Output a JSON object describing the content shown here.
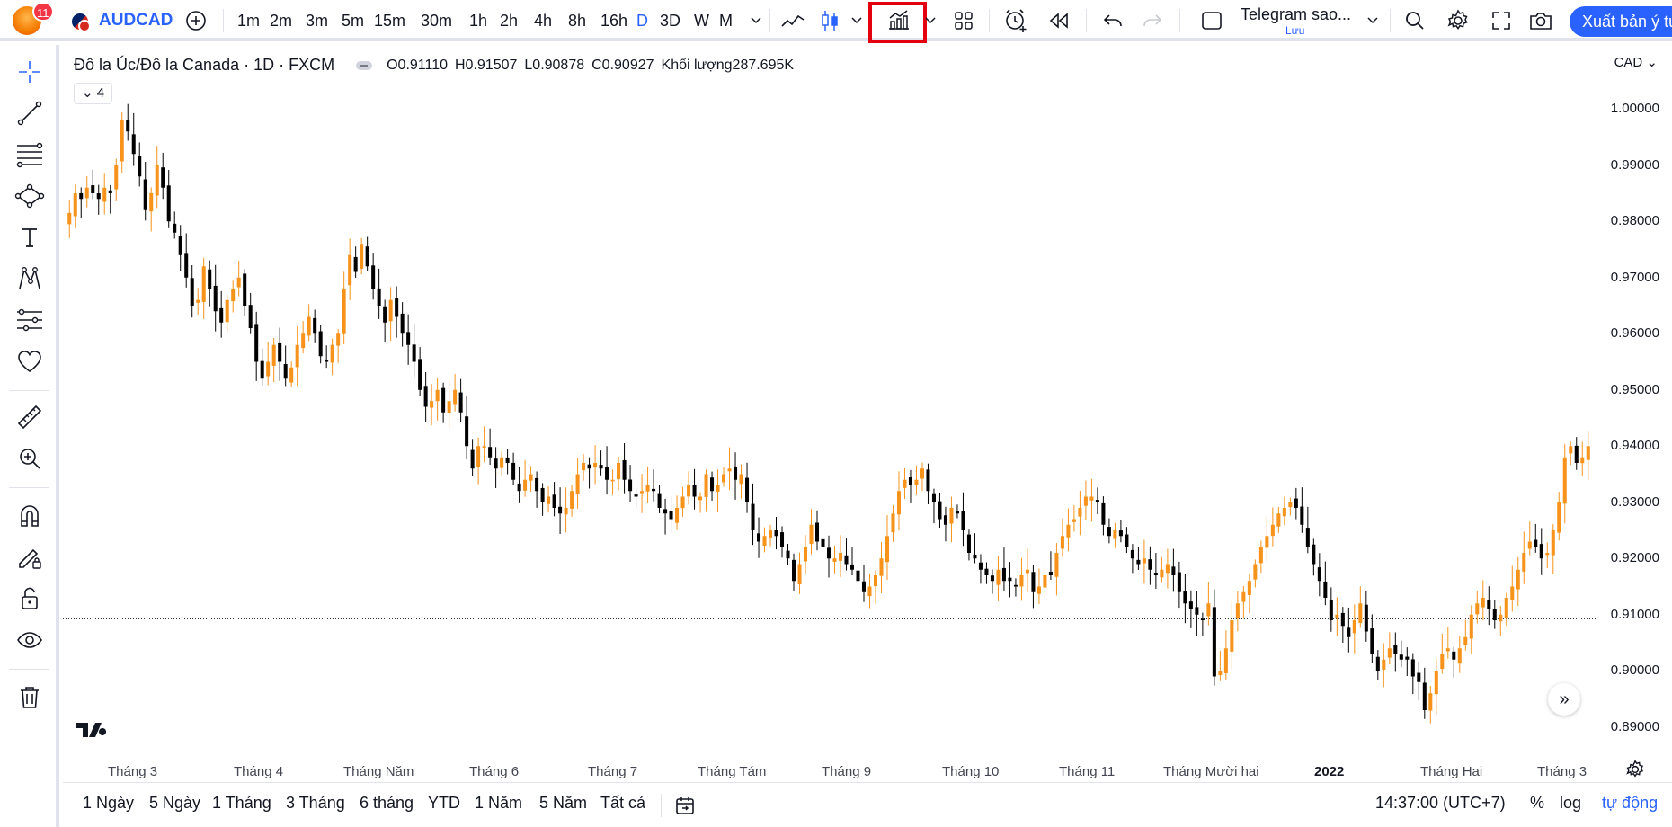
{
  "header": {
    "notification_count": "11",
    "symbol": "AUDCAD",
    "timeframes": [
      "1m",
      "2m",
      "3m",
      "5m",
      "15m",
      "30m",
      "1h",
      "2h",
      "4h",
      "8h",
      "16h",
      "D",
      "3D",
      "W",
      "M"
    ],
    "active_timeframe": "D",
    "layout_name": "Telegram sao...",
    "layout_save_label": "Lưu",
    "publish_label": "Xuất bản ý tưởng",
    "icons": [
      "add-symbol-icon",
      "line-chart-icon",
      "candles-icon",
      "indicators-icon",
      "layouts-icon",
      "alert-icon",
      "replay-icon",
      "undo-icon",
      "redo-icon",
      "search-icon",
      "settings-icon",
      "fullscreen-icon",
      "camera-icon"
    ]
  },
  "legend": {
    "title": "Đô la Úc/Đô la Canada · 1D · FXCM",
    "open": "O0.91110",
    "high": "H0.91507",
    "low": "L0.90878",
    "close": "C0.90927",
    "volume": "Khối lượng287.695K",
    "collapsed_count": "4"
  },
  "axis": {
    "currency": "CAD",
    "price_labels": [
      "1.00000",
      "0.99000",
      "0.98000",
      "0.97000",
      "0.96000",
      "0.95000",
      "0.94000",
      "0.93000",
      "0.92000",
      "0.91000",
      "0.90000",
      "0.89000"
    ],
    "time_labels": [
      "Tháng 3",
      "Tháng 4",
      "Tháng Năm",
      "Tháng 6",
      "Tháng 7",
      "Tháng Tám",
      "Tháng 9",
      "Tháng 10",
      "Tháng 11",
      "Tháng Mười hai",
      "2022",
      "Tháng Hai",
      "Tháng 3"
    ]
  },
  "chart_data": {
    "type": "candlestick",
    "ylim": [
      0.885,
      1.005
    ],
    "reference_price": 0.90927,
    "up_color": "#f7931a",
    "down_color": "#000000",
    "note_series": "approximate daily closes read from chart",
    "closes": [
      0.9815,
      0.985,
      0.984,
      0.986,
      0.985,
      0.984,
      0.986,
      0.985,
      0.99,
      0.998,
      0.996,
      0.992,
      0.988,
      0.982,
      0.985,
      0.99,
      0.986,
      0.98,
      0.978,
      0.974,
      0.97,
      0.965,
      0.966,
      0.972,
      0.968,
      0.964,
      0.962,
      0.966,
      0.968,
      0.97,
      0.965,
      0.961,
      0.955,
      0.952,
      0.955,
      0.958,
      0.955,
      0.952,
      0.954,
      0.958,
      0.96,
      0.963,
      0.96,
      0.956,
      0.955,
      0.958,
      0.96,
      0.968,
      0.974,
      0.971,
      0.976,
      0.972,
      0.968,
      0.965,
      0.962,
      0.966,
      0.963,
      0.96,
      0.958,
      0.955,
      0.95,
      0.947,
      0.948,
      0.95,
      0.946,
      0.948,
      0.95,
      0.946,
      0.94,
      0.936,
      0.94,
      0.94,
      0.938,
      0.936,
      0.938,
      0.937,
      0.934,
      0.932,
      0.934,
      0.935,
      0.932,
      0.93,
      0.931,
      0.929,
      0.928,
      0.929,
      0.932,
      0.935,
      0.937,
      0.936,
      0.937,
      0.936,
      0.934,
      0.934,
      0.937,
      0.934,
      0.932,
      0.931,
      0.932,
      0.933,
      0.932,
      0.929,
      0.928,
      0.927,
      0.929,
      0.931,
      0.933,
      0.931,
      0.931,
      0.935,
      0.932,
      0.933,
      0.935,
      0.936,
      0.934,
      0.935,
      0.93,
      0.925,
      0.923,
      0.924,
      0.925,
      0.924,
      0.922,
      0.92,
      0.916,
      0.919,
      0.922,
      0.926,
      0.923,
      0.922,
      0.92,
      0.92,
      0.921,
      0.919,
      0.918,
      0.916,
      0.914,
      0.915,
      0.917,
      0.92,
      0.924,
      0.928,
      0.932,
      0.934,
      0.933,
      0.934,
      0.936,
      0.932,
      0.93,
      0.927,
      0.926,
      0.929,
      0.928,
      0.925,
      0.921,
      0.92,
      0.918,
      0.917,
      0.916,
      0.918,
      0.916,
      0.916,
      0.915,
      0.917,
      0.918,
      0.914,
      0.915,
      0.917,
      0.917,
      0.921,
      0.924,
      0.926,
      0.927,
      0.929,
      0.931,
      0.931,
      0.93,
      0.926,
      0.924,
      0.925,
      0.924,
      0.922,
      0.92,
      0.919,
      0.92,
      0.918,
      0.917,
      0.918,
      0.919,
      0.917,
      0.914,
      0.912,
      0.911,
      0.91,
      0.909,
      0.912,
      0.899,
      0.9,
      0.904,
      0.909,
      0.912,
      0.914,
      0.916,
      0.919,
      0.922,
      0.924,
      0.926,
      0.928,
      0.929,
      0.93,
      0.929,
      0.926,
      0.922,
      0.919,
      0.916,
      0.913,
      0.909,
      0.91,
      0.908,
      0.906,
      0.909,
      0.912,
      0.907,
      0.903,
      0.9,
      0.902,
      0.904,
      0.903,
      0.902,
      0.902,
      0.899,
      0.898,
      0.893,
      0.896,
      0.9,
      0.903,
      0.904,
      0.902,
      0.904,
      0.906,
      0.91,
      0.912,
      0.913,
      0.911,
      0.909,
      0.91,
      0.913,
      0.915,
      0.918,
      0.921,
      0.923,
      0.922,
      0.92,
      0.921,
      0.925,
      0.93,
      0.938,
      0.94,
      0.937,
      0.938,
      0.94
    ]
  },
  "bottom": {
    "ranges": [
      "1 Ngày",
      "5 Ngày",
      "1 Tháng",
      "3 Tháng",
      "6 tháng",
      "YTD",
      "1 Năm",
      "5 Năm",
      "Tất cả"
    ],
    "clock": "14:37:00 (UTC+7)",
    "percent": "%",
    "log": "log",
    "auto": "tự động"
  }
}
